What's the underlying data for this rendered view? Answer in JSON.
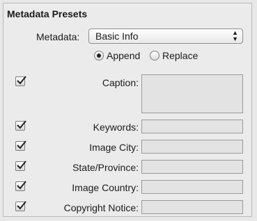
{
  "panel": {
    "title": "Metadata Presets"
  },
  "metadata": {
    "label": "Metadata:",
    "selected": "Basic Info"
  },
  "mode": {
    "append_label": "Append",
    "replace_label": "Replace",
    "selected": "Append"
  },
  "fields": [
    {
      "label": "Caption:",
      "checked": true,
      "value": ""
    },
    {
      "label": "Keywords:",
      "checked": true,
      "value": ""
    },
    {
      "label": "Image City:",
      "checked": true,
      "value": ""
    },
    {
      "label": "State/Province:",
      "checked": true,
      "value": ""
    },
    {
      "label": "Image Country:",
      "checked": true,
      "value": ""
    },
    {
      "label": "Copyright Notice:",
      "checked": true,
      "value": ""
    }
  ]
}
